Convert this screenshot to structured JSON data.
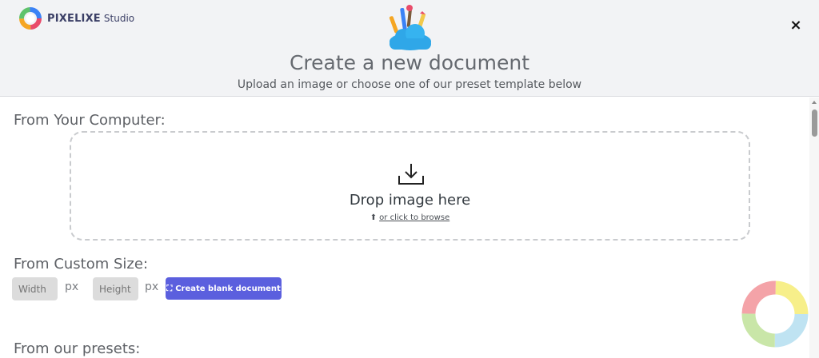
{
  "header": {
    "brand_name": "PIXELIXE",
    "brand_sub": "Studio",
    "close_label": "×",
    "title": "Create a new document",
    "subtitle": "Upload an image or choose one of our preset template below"
  },
  "computer_section": {
    "label": "From Your Computer:",
    "drop_text": "Drop image here",
    "browse_text": "or click to browse",
    "browse_icon": "⬆"
  },
  "custom_size": {
    "label": "From Custom Size:",
    "width_placeholder": "Width",
    "height_placeholder": "Height",
    "unit": "px",
    "create_label": "Create blank document",
    "create_icon": "⛶"
  },
  "presets": {
    "label": "From our presets:"
  },
  "colors": {
    "accent": "#5b5fde",
    "brand": "#3b3f66",
    "header_bg": "#f2f3f5"
  },
  "icons": {
    "close": "close-icon",
    "download": "download-icon",
    "upload": "upload-icon",
    "expand": "expand-icon",
    "hero": "cloud-paint-tools-icon",
    "logo": "pixelixe-logo-icon",
    "loader": "loading-ring-icon"
  }
}
